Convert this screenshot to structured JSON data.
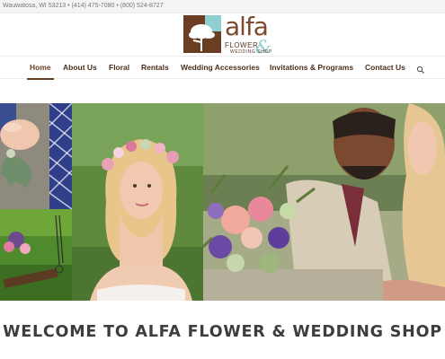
{
  "topbar": {
    "contact_text": "Wauwatosa, WI 53213 • (414) 475-7080 • (800) 524-8727"
  },
  "logo": {
    "word": "alfa",
    "subtitle": "FLOWER",
    "subtitle2": "WEDDING SHOP",
    "ampersand": "&"
  },
  "nav": {
    "items": [
      {
        "label": "Home",
        "active": true
      },
      {
        "label": "About Us"
      },
      {
        "label": "Floral"
      },
      {
        "label": "Rentals"
      },
      {
        "label": "Wedding Accessories"
      },
      {
        "label": "Invitations & Programs"
      },
      {
        "label": "Contact Us"
      }
    ],
    "search_icon": "search-icon"
  },
  "colors": {
    "brand_brown": "#6b3d22",
    "brand_teal": "#8fcfd0"
  },
  "welcome": {
    "heading": "WELCOME TO ALFA FLOWER & WEDDING SHOP"
  }
}
